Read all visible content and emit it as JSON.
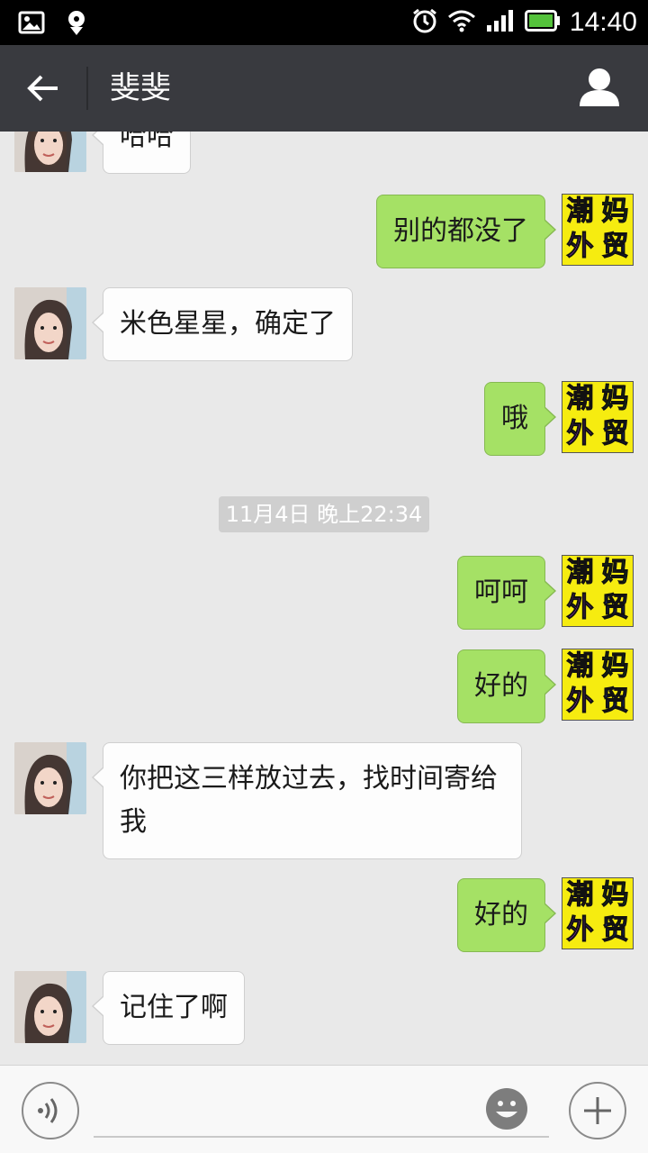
{
  "status_bar": {
    "time": "14:40",
    "icons": [
      "image-icon",
      "location-icon",
      "alarm-icon",
      "wifi-icon",
      "signal-icon",
      "battery-icon"
    ]
  },
  "title_bar": {
    "title": "斐斐"
  },
  "logo": {
    "chars": [
      "潮",
      "妈",
      "外",
      "贸"
    ],
    "colors": [
      "#e3161b",
      "#1fa62a",
      "#9b2ed6",
      "#1a3be0"
    ],
    "background": "#f6ec10"
  },
  "messages": [
    {
      "side": "left",
      "text": "哈哈"
    },
    {
      "side": "right",
      "text": "别的都没了"
    },
    {
      "side": "left",
      "text": "米色星星，确定了"
    },
    {
      "side": "right",
      "text": "哦"
    },
    {
      "side": "right",
      "text": "呵呵"
    },
    {
      "side": "right",
      "text": "好的"
    },
    {
      "side": "left",
      "text": "你把这三样放过去，找时间寄给我"
    },
    {
      "side": "right",
      "text": "好的"
    },
    {
      "side": "left",
      "text": "记住了啊"
    }
  ],
  "timestamp": "11月4日 晚上22:34",
  "colors": {
    "title_bar": "#393a3f",
    "chat_background": "#e9e9e9",
    "sent_bubble": "#a5e165",
    "received_bubble": "#fdfdfd"
  },
  "input_bar": {
    "placeholder": ""
  }
}
